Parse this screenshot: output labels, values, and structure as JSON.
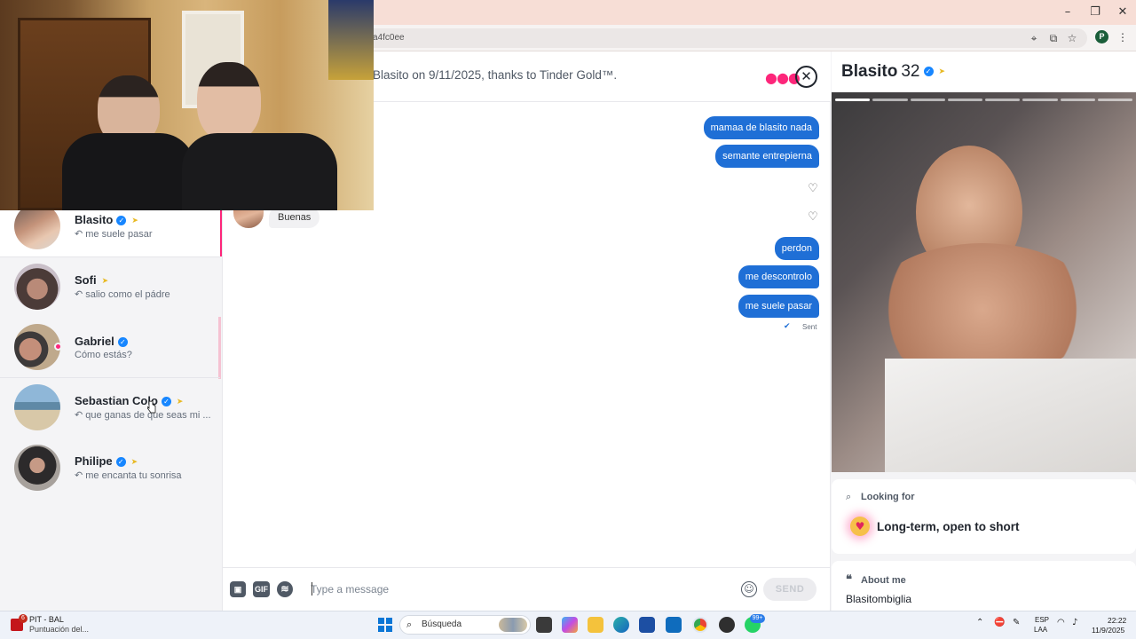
{
  "browser": {
    "url_fragment": "a4fc0ee",
    "window_controls": {
      "minimize": "–",
      "restore": "❐",
      "close": "✕"
    },
    "profile_initial": "P"
  },
  "chat": {
    "notice": "Blasito on 9/11/2025, thanks to Tinder Gold™.",
    "messages_out": [
      {
        "text": "mamaa de blasito nada"
      },
      {
        "text": "semante entrepierna"
      },
      {
        "text": "perdon"
      },
      {
        "text": "me descontrolo"
      },
      {
        "text": "me suele pasar"
      }
    ],
    "messages_in": [
      {
        "text": "Buenas"
      }
    ],
    "sent_label": "Sent",
    "composer": {
      "placeholder": "Type a message",
      "gif_label": "GIF",
      "send_label": "SEND"
    }
  },
  "matches": [
    {
      "name": "Blasito",
      "verified": true,
      "gold": true,
      "preview": "↶ me suele pasar",
      "active": true
    },
    {
      "name": "Sofi",
      "verified": false,
      "gold": true,
      "preview": "↶ salio como el pádre"
    },
    {
      "name": "Gabriel",
      "verified": true,
      "gold": false,
      "preview": "Cómo estás?",
      "online": true
    },
    {
      "name": "Sebastian Colo",
      "verified": true,
      "gold": true,
      "preview": "↶ que ganas de que seas mi ..."
    },
    {
      "name": "Philipe",
      "verified": true,
      "gold": true,
      "preview": "↶ me encanta tu sonrisa"
    }
  ],
  "profile": {
    "name": "Blasito",
    "age": "32",
    "photo_count": 8,
    "photo_active_index": 0,
    "looking_for_label": "Looking for",
    "looking_for_value": "Long-term, open to short",
    "about_label": "About me",
    "about_value": "Blasitombiglia"
  },
  "taskbar": {
    "badge_count": "6",
    "app_title": "PIT - BAL",
    "app_subtitle": "Puntuación del...",
    "search_placeholder": "Búsqueda",
    "notification_count": "99+",
    "lang_1": "ESP",
    "lang_2": "LAA",
    "time": "22:22",
    "date": "11/9/2025"
  },
  "colors": {
    "tinder_pink": "#fd267a",
    "bubble_blue": "#1f6fd6",
    "verified_blue": "#1786ff",
    "gold": "#e8b923"
  }
}
